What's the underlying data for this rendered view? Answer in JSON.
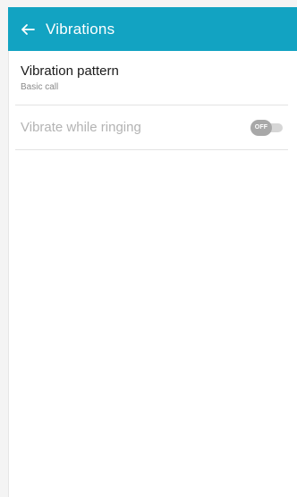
{
  "header": {
    "title": "Vibrations",
    "back_icon": "arrow-left-icon",
    "background_color": "#12a3c2"
  },
  "settings": {
    "vibration_pattern": {
      "title": "Vibration pattern",
      "value": "Basic call"
    },
    "vibrate_while_ringing": {
      "title": "Vibrate while ringing",
      "toggle_label": "OFF",
      "enabled": false
    }
  }
}
